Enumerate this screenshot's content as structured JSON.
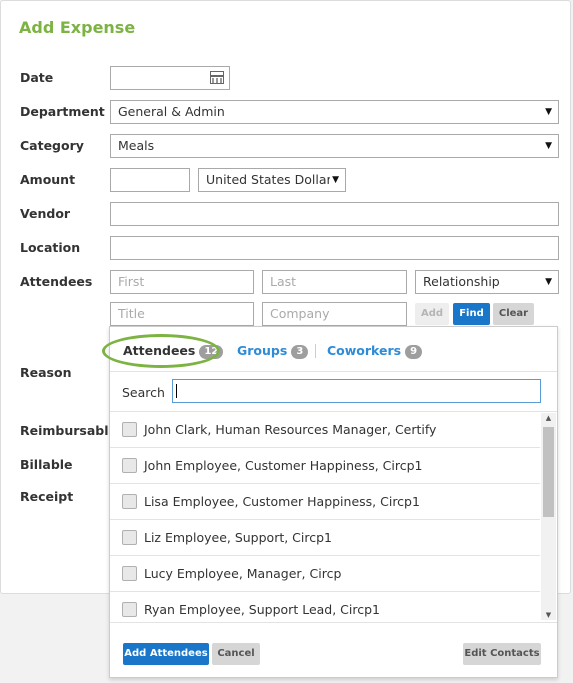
{
  "form": {
    "title": "Add Expense",
    "labels": {
      "date": "Date",
      "department": "Department",
      "category": "Category",
      "amount": "Amount",
      "vendor": "Vendor",
      "location": "Location",
      "attendees": "Attendees",
      "reason": "Reason",
      "reimbursable": "Reimbursable",
      "billable": "Billable",
      "receipt": "Receipt"
    },
    "department_value": "General & Admin",
    "category_value": "Meals",
    "currency_value": "United States Dollars",
    "attendee_fields": {
      "first_placeholder": "First",
      "last_placeholder": "Last",
      "relationship_value": "Relationship",
      "title_placeholder": "Title",
      "company_placeholder": "Company"
    },
    "buttons": {
      "add": "Add",
      "find": "Find",
      "clear": "Clear"
    }
  },
  "popup": {
    "tabs": [
      {
        "label": "Attendees",
        "count": "12"
      },
      {
        "label": "Groups",
        "count": "3"
      },
      {
        "label": "Coworkers",
        "count": "9"
      }
    ],
    "search_label": "Search",
    "search_value": "",
    "contacts": [
      "John Clark, Human Resources Manager, Certify",
      "John Employee, Customer Happiness, Circp1",
      "Lisa Employee, Customer Happiness, Circp1",
      "Liz Employee, Support, Circp1",
      "Lucy Employee, Manager, Circp",
      "Ryan Employee, Support Lead, Circp1"
    ],
    "buttons": {
      "add_attendees": "Add Attendees",
      "cancel": "Cancel",
      "edit_contacts": "Edit Contacts"
    }
  },
  "colors": {
    "accent_green": "#7cb342",
    "link_blue": "#2e8bd6",
    "primary_button": "#1976c9"
  }
}
